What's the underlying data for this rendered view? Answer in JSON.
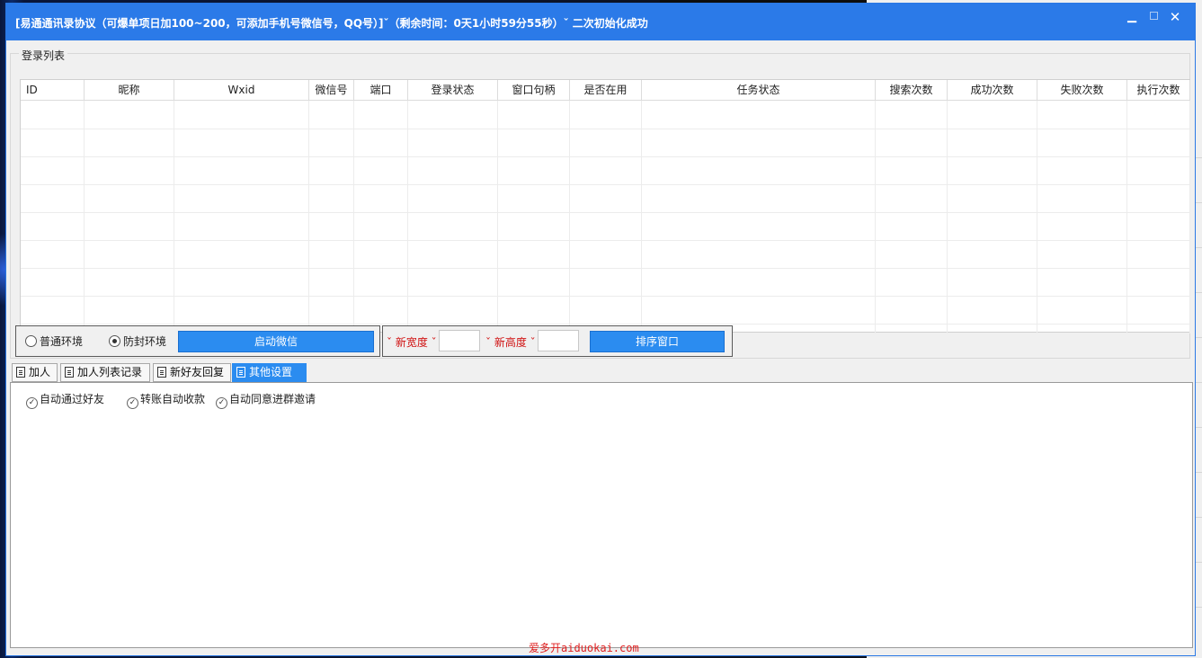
{
  "window": {
    "title": "[易通通讯录协议（可爆单项日加100~200，可添加手机号微信号，QQ号）]ˇ（剩余时间：0天1小时59分55秒）ˇ 二次初始化成功",
    "controls": {
      "minimize": "▁",
      "maximize": "□",
      "close": "✕"
    }
  },
  "login_list": {
    "label": "登录列表",
    "columns": [
      "ID",
      "昵称",
      "Wxid",
      "微信号",
      "端口",
      "登录状态",
      "窗口句柄",
      "是否在用",
      "任务状态",
      "搜索次数",
      "成功次数",
      "失败次数",
      "执行次数"
    ],
    "rows": []
  },
  "environment": {
    "normal_label": "普通环境",
    "protected_label": "防封环境",
    "selected": "防封环境",
    "start_button": "启动微信"
  },
  "window_size": {
    "width_label": "ˇ 新宽度 ˇ",
    "width_value": "",
    "height_label": "ˇ 新高度 ˇ",
    "height_value": "",
    "sort_button": "排序窗口"
  },
  "tabs": {
    "items": [
      "加人",
      "加人列表记录",
      "新好友回复",
      "其他设置"
    ],
    "active": "其他设置"
  },
  "other_settings": {
    "options": [
      "自动通过好友",
      "转账自动收款",
      "自动同意进群邀请"
    ]
  },
  "watermark": "爱多开aiduokai.com",
  "colors": {
    "titlebar": "#2b7ae8",
    "accent_button": "#2b8cf0",
    "label_red": "#d01010"
  }
}
